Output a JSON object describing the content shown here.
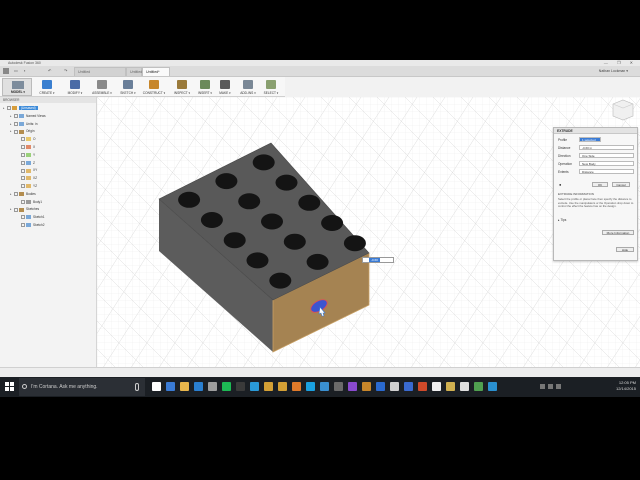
{
  "window": {
    "title": "Autodesk Fusion 360",
    "controls": "— ❐ ✕"
  },
  "tabs": [
    {
      "label": "Untitled",
      "active": false
    },
    {
      "label": "Untitled(1)",
      "active": false
    },
    {
      "label": "Untitled*",
      "active": true
    }
  ],
  "user": "Nathan Lockman ▾",
  "toolbar": {
    "workspace": "MODEL ▾",
    "items": [
      "CREATE ▾",
      "MODIFY ▾",
      "ASSEMBLE ▾",
      "SKETCH ▾",
      "CONSTRUCT ▾",
      "INSPECT ▾",
      "INSERT ▾",
      "MAKE ▾",
      "ADD-INS ▾",
      "SELECT ▾"
    ]
  },
  "browser": {
    "header": "BROWSER",
    "nodes": [
      {
        "label": "(Unsaved)",
        "indent": 0,
        "selected": true
      },
      {
        "label": "Named Views",
        "indent": 1
      },
      {
        "label": "Units: in",
        "indent": 1
      },
      {
        "label": "Origin",
        "indent": 1
      },
      {
        "label": "O",
        "indent": 2
      },
      {
        "label": "X",
        "indent": 2
      },
      {
        "label": "Y",
        "indent": 2
      },
      {
        "label": "Z",
        "indent": 2
      },
      {
        "label": "XY",
        "indent": 2
      },
      {
        "label": "XZ",
        "indent": 2
      },
      {
        "label": "YZ",
        "indent": 2
      },
      {
        "label": "Bodies",
        "indent": 1
      },
      {
        "label": "Body1",
        "indent": 2
      },
      {
        "label": "Sketches",
        "indent": 1
      },
      {
        "label": "Sketch1",
        "indent": 2
      },
      {
        "label": "Sketch2",
        "indent": 2
      }
    ]
  },
  "extrude": {
    "title": "EXTRUDE",
    "fields": [
      {
        "label": "Profile",
        "value": "1 selected"
      },
      {
        "label": "Distance",
        "value": "-0.60 in"
      },
      {
        "label": "Direction",
        "value": "One Side"
      },
      {
        "label": "Operation",
        "value": "New Body"
      },
      {
        "label": "Extents",
        "value": "Distance"
      }
    ],
    "ok": "OK",
    "cancel": "Cancel",
    "info_title": "EXTRUDE INFORMATION",
    "info_text": "Select the profile or planar face then specify the distance to extrude. Use the manipulators or the Operation drop down to control the effect the feature has on the design.",
    "tips": "Tips",
    "more_info": "More Information",
    "hide": "Hide"
  },
  "dimension_value": "-0.60",
  "search": {
    "placeholder": "I'm Cortana. Ask me anything."
  },
  "clock": {
    "time": "12:05 PM",
    "date": "12/14/2015"
  },
  "colors": {
    "block_top": "#575757",
    "block_side": "#5e5e5e",
    "block_front": "#9b7a4a",
    "selection": "#3b8ad9",
    "hole_profile": "#3c55d0"
  }
}
